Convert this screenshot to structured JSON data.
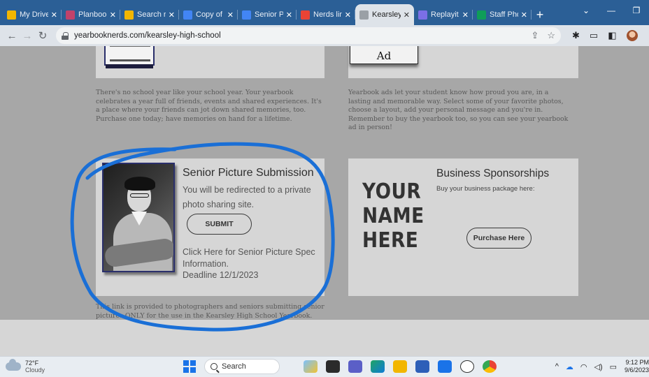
{
  "browser": {
    "tabs": [
      {
        "title": "My Drive",
        "color": "#f2b600",
        "icon": "drive-icon"
      },
      {
        "title": "Planbook",
        "color": "#c1426b",
        "icon": "planbook-icon"
      },
      {
        "title": "Search re",
        "color": "#f2b600",
        "icon": "drive-icon"
      },
      {
        "title": "Copy of",
        "color": "#4285f4",
        "icon": "docs-icon"
      },
      {
        "title": "Senior P",
        "color": "#4285f4",
        "icon": "docs-icon"
      },
      {
        "title": "Nerds lin",
        "color": "#ea4335",
        "icon": "gmail-icon"
      },
      {
        "title": "Kearsley",
        "color": "#dee3e9",
        "icon": "site-icon",
        "active": true
      },
      {
        "title": "Replayit",
        "color": "#7b6fe6",
        "icon": "replayit-icon"
      },
      {
        "title": "Staff Pho",
        "color": "#0f9d58",
        "icon": "sheets-icon"
      }
    ],
    "new_tab_symbol": "+",
    "url": "yearbooknerds.com/kearsley-high-school"
  },
  "page": {
    "top_right_ad_label": "Ad",
    "blurb_left": "There's no school year like your school year. Your yearbook celebrates a year full of friends, events and shared experiences. It's a place where your friends can jot down shared memories, too. Purchase one today; have memories on hand for a lifetime.",
    "blurb_right": "Yearbook ads let your student know how proud you are, in a lasting and memorable way. Select some of your favorite photos, choose a layout, add your personal message and you're in. Remember to buy the yearbook too, so you can see your yearbook ad in person!",
    "senior": {
      "title": "Senior Picture Submission",
      "description": "You will be redirected to a private photo sharing site.",
      "submit_label": "SUBMIT",
      "spec_link": "Click Here for Senior Picture Spec Information.",
      "deadline": "Deadline 12/1/2023"
    },
    "business": {
      "title": "Business Sponsorships",
      "subtitle": "Buy your business package here:",
      "placeholder_line1": "YOUR",
      "placeholder_line2": "NAME",
      "placeholder_line3": "HERE",
      "purchase_label": "Purchase Here"
    },
    "blurb_bottom": "This link is provided to photographers and seniors submitting senior pictures ONLY for the use in the Kearsley High School Yearbook."
  },
  "annotation": {
    "color": "#1a6fd6"
  },
  "taskbar": {
    "temperature": "72°F",
    "condition": "Cloudy",
    "search_label": "Search",
    "time": "9:12 PM",
    "date": "9/6/2023"
  }
}
